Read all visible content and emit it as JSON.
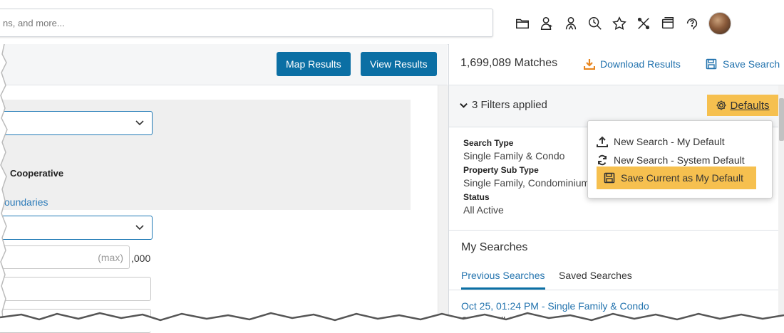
{
  "search": {
    "placeholder_visible": "ns, and more..."
  },
  "toolbar_icons": [
    "folder-icon",
    "contact-icon",
    "agent-icon",
    "search-history-icon",
    "star-icon",
    "tools-icon",
    "window-icon",
    "help-icon"
  ],
  "left": {
    "map_results": "Map Results",
    "view_results": "View Results",
    "cooperative": "Cooperative",
    "boundaries": "oundaries",
    "max_placeholder": "(max)",
    "suffix": ",000"
  },
  "right": {
    "matches": "1,699,089 Matches",
    "download": "Download Results",
    "save_search": "Save Search",
    "filters_applied": "3 Filters applied",
    "defaults": "Defaults",
    "filters": [
      {
        "label": "Search Type",
        "value": "Single Family & Condo"
      },
      {
        "label": "Property Sub Type",
        "value": "Single Family, Condominium"
      },
      {
        "label": "Status",
        "value": "All Active"
      }
    ],
    "my_searches": "My Searches",
    "tabs": [
      "Previous Searches",
      "Saved Searches"
    ],
    "recent": {
      "title": "Oct 25, 01:24 PM - Single Family & Condo",
      "status": "Status: All Active"
    }
  },
  "menu": {
    "items": [
      {
        "label": "New Search - My Default",
        "icon": "upload-icon"
      },
      {
        "label": "New Search - System Default",
        "icon": "refresh-icon"
      },
      {
        "label": "Save Current as My Default",
        "icon": "save-icon",
        "highlighted": true
      }
    ]
  },
  "colors": {
    "brand_blue": "#0b6fa4",
    "link_blue": "#2373ae",
    "highlight_yellow": "#f6c04f",
    "download_orange": "#e8861f"
  }
}
